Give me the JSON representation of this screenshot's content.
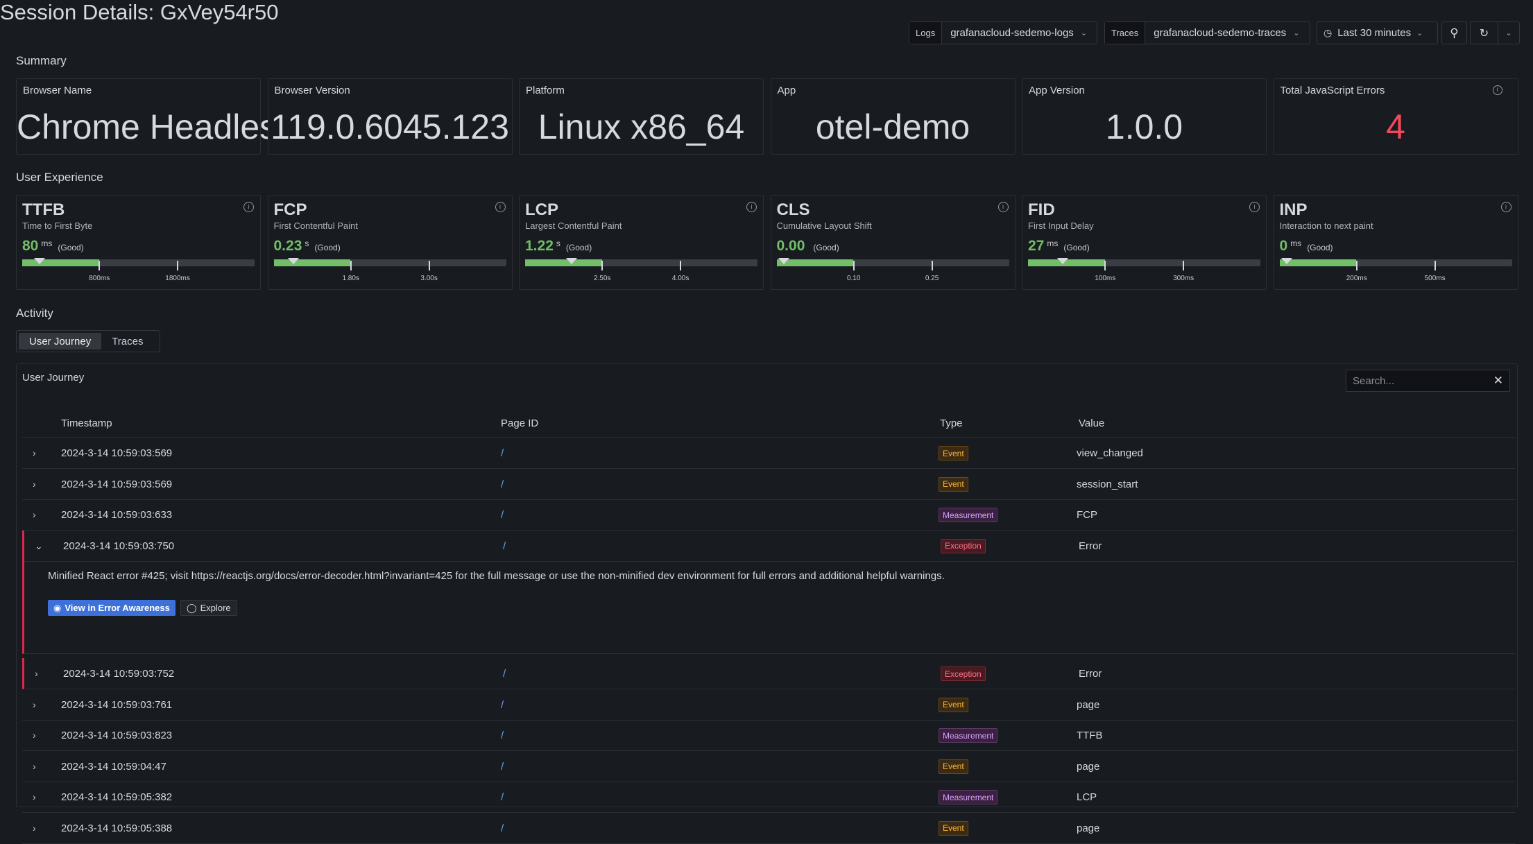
{
  "page_title": "Session Details: GxVey54r50",
  "controls": {
    "logs_label": "Logs",
    "logs_value": "grafanacloud-sedemo-logs",
    "traces_label": "Traces",
    "traces_value": "grafanacloud-sedemo-traces",
    "time_range": "Last 30 minutes"
  },
  "summary": {
    "heading": "Summary",
    "stats": [
      {
        "label": "Browser Name",
        "value": "Chrome Headless"
      },
      {
        "label": "Browser Version",
        "value": "119.0.6045.123"
      },
      {
        "label": "Platform",
        "value": "Linux x86_64"
      },
      {
        "label": "App",
        "value": "otel-demo"
      },
      {
        "label": "App Version",
        "value": "1.0.0"
      },
      {
        "label": "Total JavaScript Errors",
        "value": "4",
        "color": "#f2495c"
      }
    ]
  },
  "user_experience": {
    "heading": "User Experience",
    "metrics": [
      {
        "abbr": "TTFB",
        "name": "Time to First Byte",
        "value": "80",
        "unit": "ms",
        "rating": "(Good)",
        "fill": 0.33,
        "marker": 0.045,
        "ticks": [
          "800ms",
          "1800ms"
        ],
        "tick_pos": [
          0.33,
          0.665
        ]
      },
      {
        "abbr": "FCP",
        "name": "First Contentful Paint",
        "value": "0.23",
        "unit": "s",
        "rating": "(Good)",
        "fill": 0.33,
        "marker": 0.055,
        "ticks": [
          "1.80s",
          "3.00s"
        ],
        "tick_pos": [
          0.33,
          0.665
        ]
      },
      {
        "abbr": "LCP",
        "name": "Largest Contentful Paint",
        "value": "1.22",
        "unit": "s",
        "rating": "(Good)",
        "fill": 0.33,
        "marker": 0.17,
        "ticks": [
          "2.50s",
          "4.00s"
        ],
        "tick_pos": [
          0.33,
          0.665
        ]
      },
      {
        "abbr": "CLS",
        "name": "Cumulative Layout Shift",
        "value": "0.00",
        "unit": "",
        "rating": "(Good)",
        "fill": 0.33,
        "marker": 0.0,
        "ticks": [
          "0.10",
          "0.25"
        ],
        "tick_pos": [
          0.33,
          0.665
        ]
      },
      {
        "abbr": "FID",
        "name": "First Input Delay",
        "value": "27",
        "unit": "ms",
        "rating": "(Good)",
        "fill": 0.33,
        "marker": 0.12,
        "ticks": [
          "100ms",
          "300ms"
        ],
        "tick_pos": [
          0.33,
          0.665
        ]
      },
      {
        "abbr": "INP",
        "name": "Interaction to next paint",
        "value": "0",
        "unit": "ms",
        "rating": "(Good)",
        "fill": 0.33,
        "marker": 0.0,
        "ticks": [
          "200ms",
          "500ms"
        ],
        "tick_pos": [
          0.33,
          0.665
        ]
      }
    ]
  },
  "activity": {
    "heading": "Activity",
    "tabs": [
      "User Journey",
      "Traces"
    ],
    "panel_title": "User Journey",
    "search_placeholder": "Search...",
    "columns": [
      "Timestamp",
      "Page ID",
      "Type",
      "Value"
    ],
    "rows": [
      {
        "ts": "2024-3-14 10:59:03:569",
        "page": "/",
        "type": "Event",
        "value": "view_changed"
      },
      {
        "ts": "2024-3-14 10:59:03:569",
        "page": "/",
        "type": "Event",
        "value": "session_start"
      },
      {
        "ts": "2024-3-14 10:59:03:633",
        "page": "/",
        "type": "Measurement",
        "value": "FCP"
      },
      {
        "ts": "2024-3-14 10:59:03:750",
        "page": "/",
        "type": "Exception",
        "value": "Error",
        "expanded": true
      },
      {
        "ts": "2024-3-14 10:59:03:752",
        "page": "/",
        "type": "Exception",
        "value": "Error"
      },
      {
        "ts": "2024-3-14 10:59:03:761",
        "page": "/",
        "type": "Event",
        "value": "page"
      },
      {
        "ts": "2024-3-14 10:59:03:823",
        "page": "/",
        "type": "Measurement",
        "value": "TTFB"
      },
      {
        "ts": "2024-3-14 10:59:04:47",
        "page": "/",
        "type": "Event",
        "value": "page"
      },
      {
        "ts": "2024-3-14 10:59:05:382",
        "page": "/",
        "type": "Measurement",
        "value": "LCP"
      },
      {
        "ts": "2024-3-14 10:59:05:388",
        "page": "/",
        "type": "Event",
        "value": "page"
      }
    ],
    "expanded_message": "Minified React error #425; visit https://reactjs.org/docs/error-decoder.html?invariant=425 for the full message or use the non-minified dev environment for full errors and additional helpful warnings.",
    "expanded_buttons": [
      "View in Error Awareness",
      "Explore"
    ]
  }
}
